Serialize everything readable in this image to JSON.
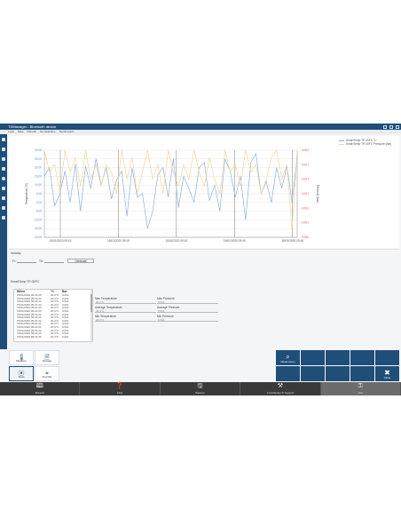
{
  "window": {
    "title": "TDManager - Bluetooth device"
  },
  "menu": {
    "items": [
      "Load",
      "Save",
      "Refresh",
      "Set date/time",
      "Synchronize"
    ]
  },
  "chart_data": {
    "type": "line",
    "y_left": {
      "label": "Temperature (°C)",
      "ticks": [
        "30,00",
        "25,00",
        "20,00",
        "15,00",
        "10,00",
        "5,00",
        "0,00",
        "-5,00",
        "-10,00",
        "-15,00",
        "-20,00"
      ],
      "range": [
        -20,
        30
      ]
    },
    "y_right": {
      "label": "Pressure (bar)",
      "ticks": [
        "0,001",
        "0,001",
        "0,001",
        "0,001",
        "0,001",
        "0,001",
        "0,000"
      ],
      "range": [
        0,
        6
      ]
    },
    "x_ticks": [
      "15/01/2020 09:15",
      "15/01/2020 09:15",
      "15/01/2020 09:16",
      "15/01/2020 09:16",
      "15/01/2020 09:16"
    ],
    "grid": true,
    "legend_position": "right",
    "series": [
      {
        "name": "SmartTemp TP-00FC °C",
        "color": "#8fb1d9",
        "axis": "left",
        "values": [
          15,
          20,
          -2,
          5,
          18,
          0,
          22,
          -5,
          21,
          8,
          25,
          10,
          20,
          2,
          13,
          18,
          -8,
          20,
          3,
          5,
          -15,
          -5,
          16,
          20,
          3,
          25,
          -3,
          15,
          8,
          0,
          20,
          23,
          1,
          10,
          -5,
          25,
          18,
          3,
          15,
          -10,
          23,
          28,
          5,
          12,
          0,
          20,
          8,
          21,
          0,
          27
        ]
      },
      {
        "name": "SmartTemp TP-00FC Pressure (bar)",
        "color": "#f3d59a",
        "axis": "right",
        "values": [
          6,
          4.5,
          5,
          3,
          6,
          4.5,
          5.5,
          3.5,
          6,
          4,
          5,
          3.5,
          5,
          4.5,
          3,
          6,
          4,
          5.5,
          3,
          4.5,
          6,
          4,
          5,
          3,
          6,
          4.5,
          3.5,
          5,
          4,
          6,
          4.5,
          3.5,
          5.5,
          4,
          3,
          6,
          4.5,
          5,
          3.5,
          6,
          4.5,
          5,
          3,
          4,
          5.5,
          6,
          4,
          5,
          0.5,
          6
        ]
      }
    ]
  },
  "velocity": {
    "label": "Velocity",
    "from_label": "Fr:",
    "to_label": "Til:",
    "from_value": "",
    "to_value": "",
    "generate_label": "Generate"
  },
  "device_section": {
    "title": "SmartTemp TP-00FC"
  },
  "table": {
    "headers": [
      "When",
      "°C",
      "Bar"
    ],
    "rows": [
      [
        "15/01/2020 09:16:25",
        "20,3°C",
        "0,001"
      ],
      [
        "15/01/2020 09:16:24",
        "20,3°C",
        "0,001"
      ],
      [
        "15/01/2020 09:16:24",
        "20,3°C",
        "0,001"
      ],
      [
        "15/01/2020 09:16:23",
        "20,3°C",
        "0,001"
      ],
      [
        "15/01/2020 09:16:23",
        "20,3°C",
        "0,001"
      ],
      [
        "15/01/2020 09:16:23",
        "20,3°C",
        "0,001"
      ],
      [
        "15/01/2020 09:16:22",
        "20,3°C",
        "0,001"
      ],
      [
        "15/01/2020 09:16:22",
        "20,3°C",
        "0,001"
      ],
      [
        "15/01/2020 09:16:22",
        "20,3°C",
        "0,001"
      ],
      [
        "15/01/2020 09:16:21",
        "20,3°C",
        "0,001"
      ],
      [
        "15/01/2020 09:16:21",
        "20,3°C",
        "0,001"
      ],
      [
        "15/01/2020 09:16:20",
        "20,3°C",
        "0,001"
      ],
      [
        "15/01/2020 09:16:20",
        "20,3°C",
        "0,001"
      ],
      [
        "15/01/2020 09:16:20",
        "20,3°C",
        "0,001"
      ]
    ]
  },
  "stats": {
    "max_temp": {
      "label": "Max Temperature",
      "value": "20,3°C"
    },
    "max_pressure": {
      "label": "Max Pressure",
      "value": "0,001"
    },
    "avg_temp": {
      "label": "Average Temperature",
      "value": "20,3°C"
    },
    "avg_pressure": {
      "label": "Average Pressure",
      "value": "0,001"
    },
    "min_temp": {
      "label": "Min Temperature",
      "value": "20,3°C"
    },
    "min_pressure": {
      "label": "Min Pressure",
      "value": "0,001"
    }
  },
  "tiles": {
    "measure": {
      "label": "Measure",
      "icon": "thermometer-icon"
    },
    "storage": {
      "label": "Storage",
      "icon": "document-icon"
    },
    "scan": {
      "label": "Scan",
      "icon": "bluetooth-icon"
    },
    "find_me": {
      "label": "Find Me",
      "icon": "pin-icon"
    },
    "reset_zoom": {
      "label": "Reset zoom",
      "icon": "zoom-icon"
    },
    "close": {
      "label": "Close",
      "icon": "close-icon"
    }
  },
  "bottombar": {
    "items": [
      {
        "label": "Manual",
        "icon": "book-icon"
      },
      {
        "label": "FAQ",
        "icon": "faq-icon"
      },
      {
        "label": "Backup",
        "icon": "save-icon"
      },
      {
        "label": "Contribution & Support",
        "icon": "tool-icon"
      },
      {
        "label": "Exit",
        "icon": "key-icon"
      }
    ]
  },
  "colors": {
    "brand": "#1f4e79",
    "temp": "#8fb1d9",
    "pressure": "#f3d59a",
    "right_axis": "#e05050"
  }
}
